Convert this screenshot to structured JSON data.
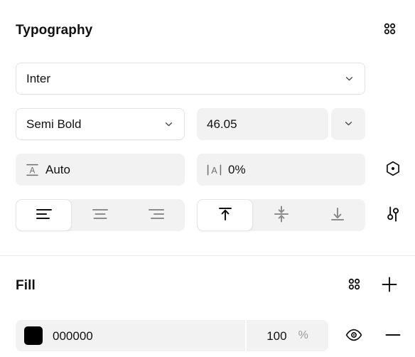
{
  "typography": {
    "title": "Typography",
    "apply_variable_icon": "grid-dots-icon",
    "font_family": {
      "value": "Inter",
      "chevron_icon": "chevron-down-icon"
    },
    "font_weight": {
      "value": "Semi Bold",
      "chevron_icon": "chevron-down-icon"
    },
    "font_size": {
      "value": "46.05",
      "chevron_icon": "chevron-down-icon"
    },
    "line_height": {
      "icon": "line-height-icon",
      "value": "Auto"
    },
    "letter_spacing": {
      "icon": "letter-spacing-icon",
      "value": "0%"
    },
    "variable_icon": "hexagon-dot-icon",
    "type_settings_icon": "sliders-icon",
    "horizontal_align": {
      "selected": 0,
      "options": [
        {
          "label": "Align left",
          "icon": "align-left-icon"
        },
        {
          "label": "Align center",
          "icon": "align-center-icon"
        },
        {
          "label": "Align right",
          "icon": "align-right-icon"
        }
      ]
    },
    "vertical_align": {
      "selected": 0,
      "options": [
        {
          "label": "Align top",
          "icon": "align-top-icon"
        },
        {
          "label": "Align middle",
          "icon": "align-middle-icon"
        },
        {
          "label": "Align bottom",
          "icon": "align-bottom-icon"
        }
      ]
    }
  },
  "fill": {
    "title": "Fill",
    "apply_variable_icon": "grid-dots-icon",
    "add_icon": "plus-icon",
    "rows": [
      {
        "color": "#000000",
        "hex": "000000",
        "opacity": "100",
        "opacity_unit": "%",
        "visibility_icon": "eye-icon",
        "remove_icon": "minus-icon"
      }
    ]
  },
  "colors": {
    "field_bg": "#f2f2f2",
    "text": "#111111",
    "muted": "#8c8c8c",
    "divider": "#eaeaea"
  }
}
